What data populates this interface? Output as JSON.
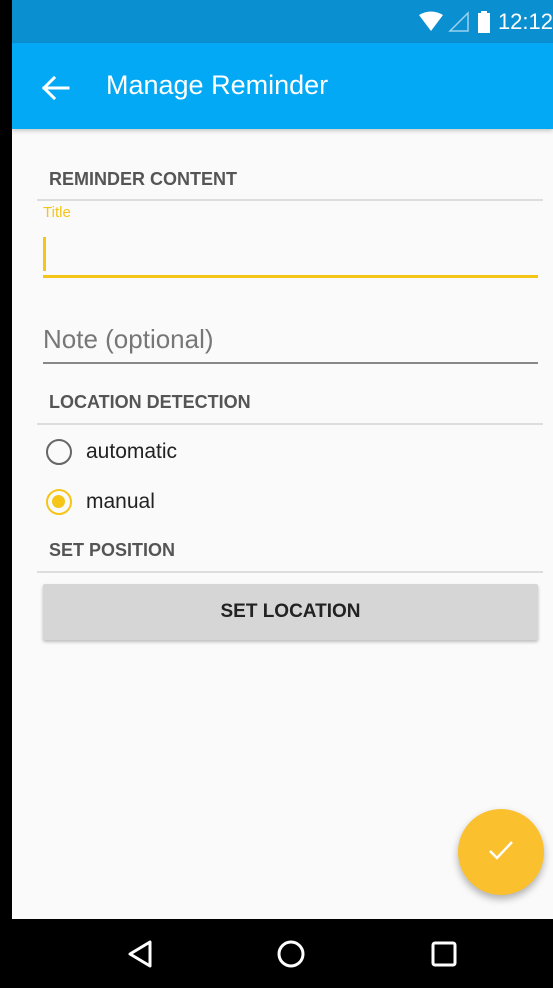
{
  "status_bar": {
    "time": "12:12",
    "wifi_icon": "wifi-icon",
    "signal_icon": "signal-icon",
    "battery_icon": "battery-icon"
  },
  "app_bar": {
    "title": "Manage Reminder",
    "back_icon": "arrow-back-icon"
  },
  "sections": {
    "reminder_content": "REMINDER CONTENT",
    "location_detection": "LOCATION DETECTION",
    "set_position": "SET POSITION"
  },
  "form": {
    "title_label": "Title",
    "title_value": "",
    "note_placeholder": "Note (optional)",
    "note_value": ""
  },
  "location_options": [
    {
      "label": "automatic",
      "selected": false
    },
    {
      "label": "manual",
      "selected": true
    }
  ],
  "set_location_label": "SET LOCATION",
  "fab_icon": "check-icon",
  "nav_icons": [
    "back-triangle-icon",
    "home-circle-icon",
    "recents-square-icon"
  ],
  "colors": {
    "primary": "#03a9f4",
    "primary_dark": "#0a8fd1",
    "accent": "#f5c518",
    "fab": "#fbc02d"
  }
}
